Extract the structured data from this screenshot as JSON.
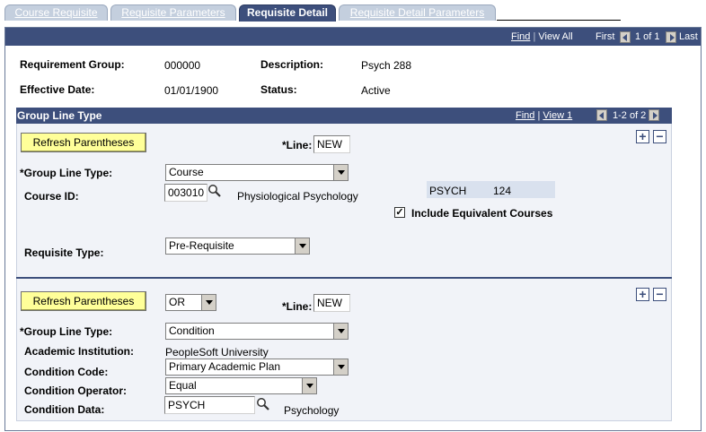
{
  "tabs": [
    {
      "label": "Course Requisite",
      "active": false
    },
    {
      "label": "Requisite Parameters",
      "active": false
    },
    {
      "label": "Requisite Detail",
      "active": true
    },
    {
      "label": "Requisite Detail Parameters",
      "active": false
    }
  ],
  "nav": {
    "find": "Find",
    "sep": "|",
    "view_all": "View All",
    "first": "First",
    "counter": "1 of 1",
    "last": "Last"
  },
  "header": {
    "requirement_group_label": "Requirement Group:",
    "requirement_group_value": "000000",
    "description_label": "Description:",
    "description_value": "Psych 288",
    "effective_date_label": "Effective Date:",
    "effective_date_value": "01/01/1900",
    "status_label": "Status:",
    "status_value": "Active"
  },
  "group": {
    "title": "Group Line Type",
    "find": "Find",
    "sep": "|",
    "view": "View 1",
    "counter": "1-2 of 2"
  },
  "row1": {
    "refresh_label": "Refresh Parentheses",
    "line_label": "*Line:",
    "line_value": "NEW",
    "group_line_type_label": "*Group Line Type:",
    "group_line_type_value": "Course",
    "course_id_label": "Course ID:",
    "course_id_value": "003010",
    "course_title": "Physiological Psychology",
    "subject": "PSYCH",
    "catalog_nbr": "124",
    "include_equiv_label": "Include Equivalent Courses",
    "include_equiv_checked": true,
    "requisite_type_label": "Requisite Type:",
    "requisite_type_value": "Pre-Requisite"
  },
  "row2": {
    "refresh_label": "Refresh Parentheses",
    "connector_value": "OR",
    "line_label": "*Line:",
    "line_value": "NEW",
    "group_line_type_label": "*Group Line Type:",
    "group_line_type_value": "Condition",
    "institution_label": "Academic Institution:",
    "institution_value": "PeopleSoft University",
    "condition_code_label": "Condition Code:",
    "condition_code_value": "Primary Academic Plan",
    "condition_operator_label": "Condition Operator:",
    "condition_operator_value": "Equal",
    "condition_data_label": "Condition Data:",
    "condition_data_value": "PSYCH",
    "condition_data_desc": "Psychology"
  },
  "icons": {
    "plus": "+",
    "minus": "−",
    "check": "✓"
  },
  "colors": {
    "header_bg": "#3d4f7c",
    "tab_inactive": "#c4cfde",
    "button_bg": "#ffff99",
    "group_bg": "#f1f3f8"
  }
}
